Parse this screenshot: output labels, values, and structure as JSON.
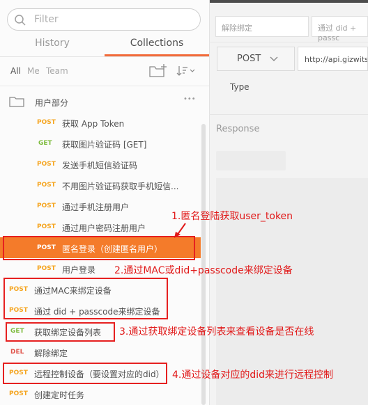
{
  "sidebar": {
    "filter_placeholder": "Filter",
    "tabs": [
      {
        "label": "History"
      },
      {
        "label": "Collections"
      }
    ],
    "scope": [
      {
        "label": "All"
      },
      {
        "label": "Me"
      },
      {
        "label": "Team"
      }
    ],
    "folder": {
      "name": "用户部分",
      "more": "•••"
    },
    "requests": [
      {
        "method": "POST",
        "name": "获取 App Token"
      },
      {
        "method": "GET",
        "name": "获取图片验证码 [GET]"
      },
      {
        "method": "POST",
        "name": "发送手机短信验证码"
      },
      {
        "method": "POST",
        "name": "不用图片验证码获取手机短信..."
      },
      {
        "method": "POST",
        "name": "通过手机注册用户"
      },
      {
        "method": "POST",
        "name": "通过用户密码注册用户"
      },
      {
        "method": "POST",
        "name": "匿名登录（创建匿名用户）"
      },
      {
        "method": "POST",
        "name": "用户登录"
      },
      {
        "method": "POST",
        "name": "通过MAC来绑定设备"
      },
      {
        "method": "POST",
        "name": "通过 did + passcode来绑定设备"
      },
      {
        "method": "GET",
        "name": "获取绑定设备列表"
      },
      {
        "method": "DEL",
        "name": "解除绑定"
      },
      {
        "method": "POST",
        "name": "远程控制设备（要设置对应的did）"
      },
      {
        "method": "POST",
        "name": "创建定时任务"
      }
    ]
  },
  "annotations": [
    "1.匿名登陆获取user_token",
    "2.通过MAC或did+passcode来绑定设备",
    "3.通过获取绑定设备列表来查看设备是否在线",
    "4.通过设备对应的did来进行远程控制"
  ],
  "main": {
    "open_tabs": [
      {
        "label": "解除绑定"
      },
      {
        "label": "通过 did + passc"
      }
    ],
    "method": "POST",
    "url": "http://api.gizwits",
    "type_label": "Type",
    "response_label": "Response"
  },
  "colors": {
    "accent": "#f47b2a",
    "annotation": "#e11a1a",
    "post": "#f5a623",
    "get": "#7dbb3d",
    "del": "#e0534a"
  }
}
